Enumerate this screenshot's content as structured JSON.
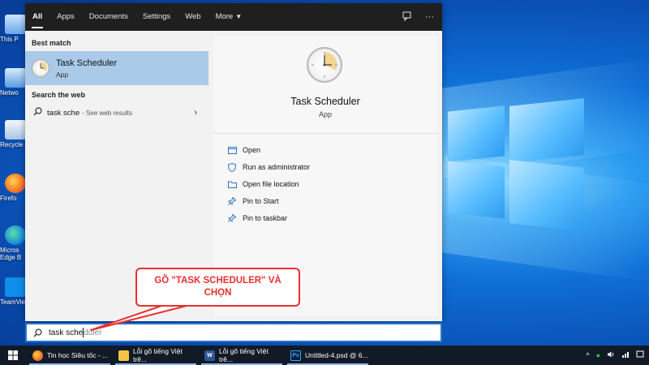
{
  "desktop": {
    "icons": [
      {
        "name": "this-pc",
        "label": "This P"
      },
      {
        "name": "network",
        "label": "Netwo"
      },
      {
        "name": "recycle-bin",
        "label": "Recycle"
      },
      {
        "name": "firefox",
        "label": "Firefo"
      },
      {
        "name": "edge-beta",
        "label": "Micros Edge B",
        "badge": "BETA"
      },
      {
        "name": "teamviewer",
        "label": "TeamVie"
      }
    ]
  },
  "search_panel": {
    "tabs": [
      {
        "label": "All",
        "active": true
      },
      {
        "label": "Apps"
      },
      {
        "label": "Documents"
      },
      {
        "label": "Settings"
      },
      {
        "label": "Web"
      },
      {
        "label": "More"
      }
    ],
    "top_icons": [
      "feedback-icon",
      "more-options-icon"
    ],
    "best_match_header": "Best match",
    "best_match": {
      "title": "Task Scheduler",
      "subtitle": "App"
    },
    "web_header": "Search the web",
    "web_result": {
      "query": "task sche",
      "suffix": "- See web results"
    },
    "details": {
      "title": "Task Scheduler",
      "subtitle": "App",
      "actions": [
        {
          "label": "Open",
          "icon": "open-icon"
        },
        {
          "label": "Run as administrator",
          "icon": "shield-icon"
        },
        {
          "label": "Open file location",
          "icon": "folder-icon"
        },
        {
          "label": "Pin to Start",
          "icon": "pin-icon"
        },
        {
          "label": "Pin to taskbar",
          "icon": "pin-icon"
        }
      ]
    }
  },
  "search_bar": {
    "typed": "task sche",
    "suggestion": "duler"
  },
  "callout": {
    "text": "GÕ \"TASK SCHEDULER\" VÀ CHỌN",
    "color": "#e8302f"
  },
  "taskbar": {
    "items": [
      {
        "label": "Tin học Siêu tốc - ...",
        "icon": "firefox-icon"
      },
      {
        "label": "Lỗi gõ tiếng Việt trê...",
        "icon": "folder-icon"
      },
      {
        "label": "Lỗi gõ tiếng Việt trê...",
        "icon": "word-icon"
      },
      {
        "label": "Untitled-4.psd @ 6...",
        "icon": "photoshop-icon"
      }
    ]
  },
  "colors": {
    "accent": "#2b73c8",
    "selection": "#a9cae8",
    "taskbar": "#111a26"
  }
}
